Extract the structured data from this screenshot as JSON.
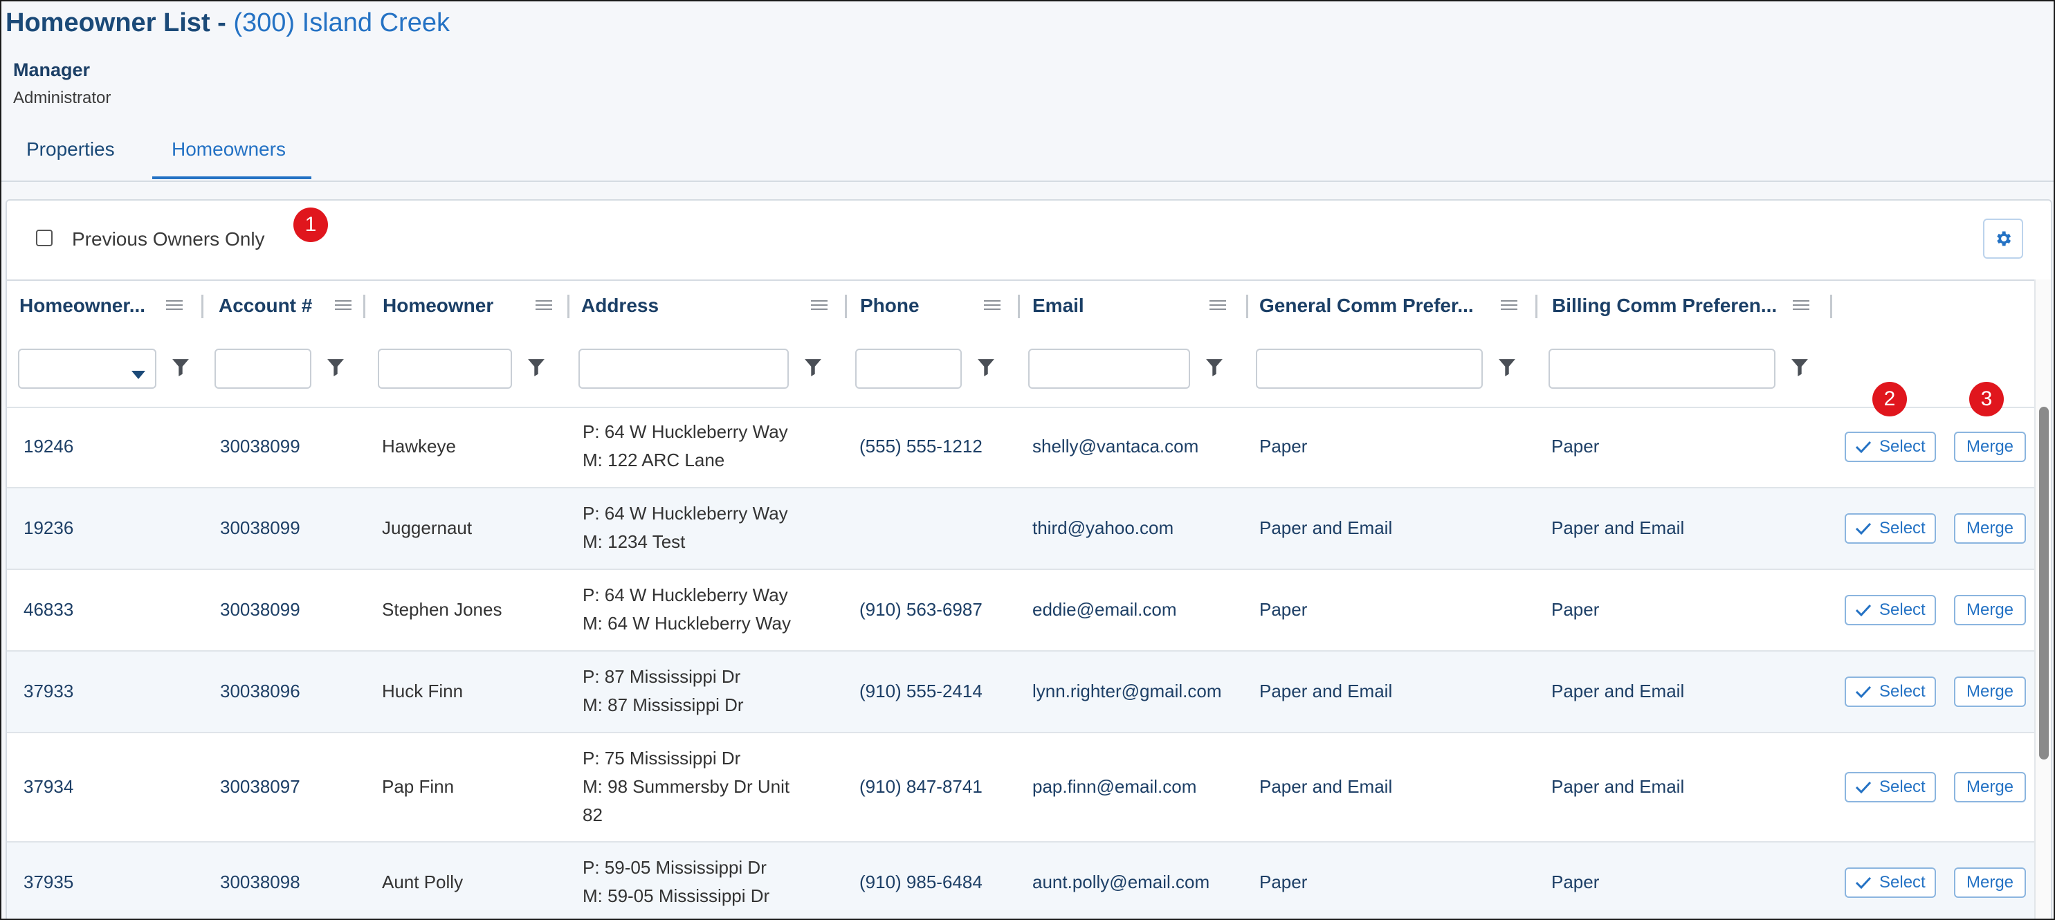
{
  "page": {
    "title_prefix": "Homeowner List - ",
    "title_community": "(300) Island Creek",
    "role": "Manager",
    "subrole": "Administrator"
  },
  "tabs": [
    {
      "label": "Properties",
      "active": false
    },
    {
      "label": "Homeowners",
      "active": true
    }
  ],
  "toolbar": {
    "previous_owners_label": "Previous Owners Only",
    "previous_owners_checked": false
  },
  "annotations": {
    "badge_1": "1",
    "badge_2": "2",
    "badge_3": "3"
  },
  "columns": [
    "Homeowner...",
    "Account #",
    "Homeowner",
    "Address",
    "Phone",
    "Email",
    "General Comm Prefer...",
    "Billing Comm Preferen..."
  ],
  "actions": {
    "select_label": "Select",
    "merge_label": "Merge"
  },
  "rows": [
    {
      "id": "19246",
      "account": "30038099",
      "name": "Hawkeye",
      "addr_p": "P: 64 W Huckleberry Way",
      "addr_m": "M: 122 ARC Lane",
      "phone": "(555) 555-1212",
      "email": "shelly@vantaca.com",
      "general": "Paper",
      "billing": "Paper"
    },
    {
      "id": "19236",
      "account": "30038099",
      "name": "Juggernaut",
      "addr_p": "P: 64 W Huckleberry Way",
      "addr_m": "M: 1234 Test",
      "phone": "",
      "email": "third@yahoo.com",
      "general": "Paper and Email",
      "billing": "Paper and Email"
    },
    {
      "id": "46833",
      "account": "30038099",
      "name": "Stephen Jones",
      "addr_p": "P: 64 W Huckleberry Way",
      "addr_m": "M: 64 W Huckleberry Way",
      "phone": "(910) 563-6987",
      "email": "eddie@email.com",
      "general": "Paper",
      "billing": "Paper"
    },
    {
      "id": "37933",
      "account": "30038096",
      "name": "Huck Finn",
      "addr_p": "P: 87 Mississippi Dr",
      "addr_m": "M: 87 Mississippi Dr",
      "phone": "(910) 555-2414",
      "email": "lynn.righter@gmail.com",
      "general": "Paper and Email",
      "billing": "Paper and Email"
    },
    {
      "id": "37934",
      "account": "30038097",
      "name": "Pap Finn",
      "addr_p": "P: 75 Mississippi Dr",
      "addr_m": "M: 98 Summersby Dr Unit 82",
      "phone": "(910) 847-8741",
      "email": "pap.finn@email.com",
      "general": "Paper and Email",
      "billing": "Paper and Email"
    },
    {
      "id": "37935",
      "account": "30038098",
      "name": "Aunt Polly",
      "addr_p": "P: 59-05 Mississippi Dr",
      "addr_m": "M: 59-05 Mississippi Dr",
      "phone": "(910) 985-6484",
      "email": "aunt.polly@email.com",
      "general": "Paper",
      "billing": "Paper"
    }
  ],
  "colors": {
    "accent": "#2472c4",
    "title": "#1b4a78",
    "badge": "#e0161d"
  },
  "icons": {
    "settings": "gear-icon",
    "filter": "filter-icon",
    "select": "checkmark-icon"
  }
}
